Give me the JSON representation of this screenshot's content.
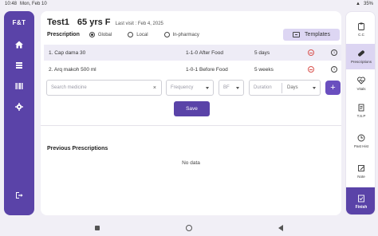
{
  "status_bar": {
    "time": "10:48",
    "date": "Mon, Feb 10",
    "battery": "35%"
  },
  "left_rail": {
    "logo": "F&T"
  },
  "patient": {
    "name": "Test1",
    "age": "65 yrs F",
    "last_visit": "Last visit : Feb 4, 2025"
  },
  "prescription": {
    "label": "Prescription",
    "options": [
      "Global",
      "Local",
      "In-pharmacy"
    ],
    "selected": "Global",
    "templates_label": "Templates",
    "medicines": [
      {
        "name": "1. Cap dama 30",
        "dose": "1-1-0  After Food",
        "duration": "5 days"
      },
      {
        "name": "2. Arq makoh 500 ml",
        "dose": "1-0-1  Before Food",
        "duration": "5 weeks"
      }
    ],
    "search_placeholder": "Search medicine",
    "frequency_placeholder": "Frequency",
    "bf_value": "BF",
    "duration_placeholder": "Duration",
    "duration_unit": "Days",
    "add_label": "+",
    "save_label": "Save"
  },
  "previous": {
    "title": "Previous Prescriptions",
    "empty_text": "No data"
  },
  "right_rail": {
    "items": [
      {
        "label": "C.C",
        "icon": "clipboard-icon"
      },
      {
        "label": "Prescriptions",
        "icon": "pill-icon"
      },
      {
        "label": "Vitals",
        "icon": "heartbeat-icon"
      },
      {
        "label": "T.S.P",
        "icon": "document-icon"
      },
      {
        "label": "Past Hist",
        "icon": "history-icon"
      },
      {
        "label": "Note",
        "icon": "note-icon"
      }
    ],
    "active": "Prescriptions",
    "finish_label": "Finish"
  }
}
